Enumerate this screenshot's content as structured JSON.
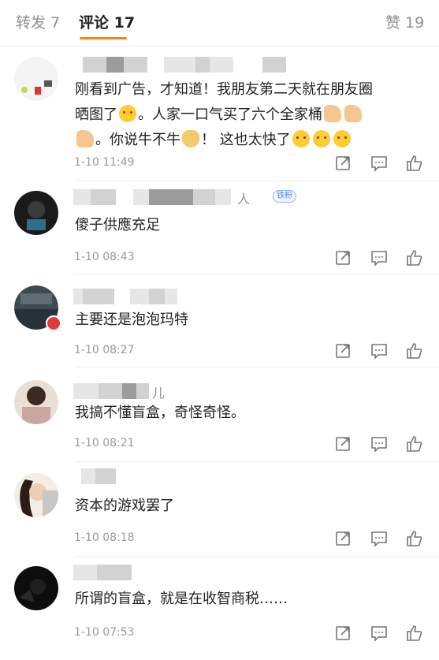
{
  "tabs": {
    "repost": "转发 7",
    "comments": "评论 17",
    "likes": "赞 19"
  },
  "comments": [
    {
      "name_tail": "",
      "badge": "",
      "text_lines": [
        "刚看到广告，才知道！我朋友第二天就在朋友圈",
        "晒图了",
        "。人家一口气买了六个全家桶",
        "。你说牛不牛",
        "！ 这也太快了"
      ],
      "time": "1-10 11:49"
    },
    {
      "name_tail": "人",
      "badge": "铁粉",
      "text": "傻子供應充足",
      "time": "1-10 08:43"
    },
    {
      "name_tail": "",
      "badge": "",
      "text": "主要还是泡泡玛特",
      "time": "1-10 08:27"
    },
    {
      "name_tail": "儿",
      "badge": "",
      "text": "我搞不懂盲盒，奇怪奇怪。",
      "time": "1-10 08:21"
    },
    {
      "name_tail": "",
      "badge": "",
      "text": "资本的游戏罢了",
      "time": "1-10 08:18"
    },
    {
      "name_tail": "",
      "badge": "",
      "text": "所谓的盲盒，就是在收智商税……",
      "time": "1-10 07:53"
    }
  ],
  "icons": {
    "repost": "share-box-icon",
    "reply": "comment-bubble-icon",
    "like": "thumbs-up-icon"
  },
  "colors": {
    "accent": "#ff8200",
    "muted": "#9a9a9a",
    "fan_badge": "#5b8dd9"
  }
}
